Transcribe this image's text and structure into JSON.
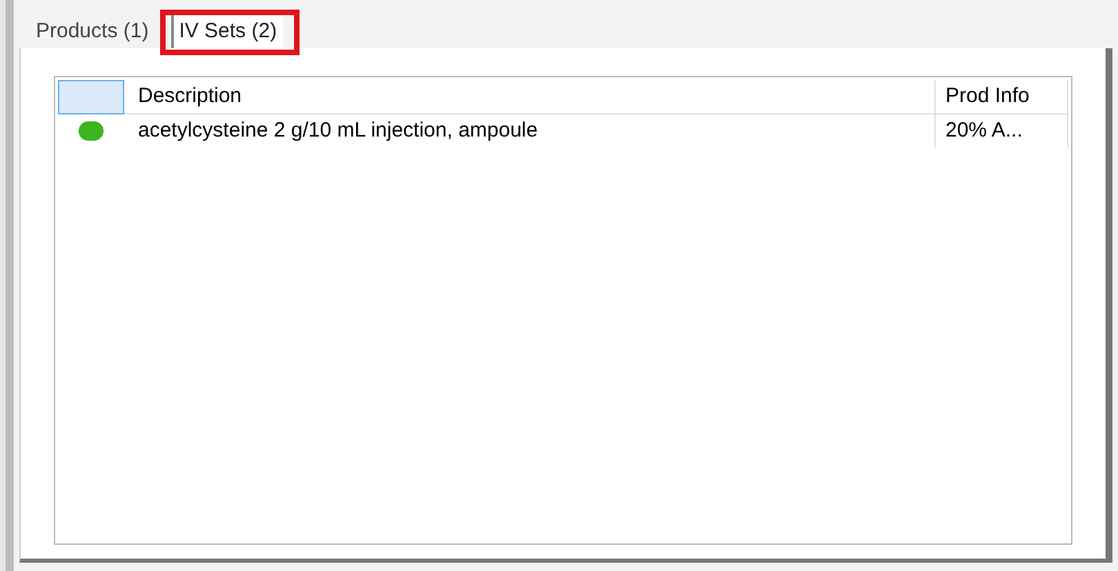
{
  "tabs": [
    {
      "label": "Products (1)",
      "selected": false,
      "highlighted": false
    },
    {
      "label": "IV Sets (2)",
      "selected": true,
      "highlighted": true
    }
  ],
  "table": {
    "columns": [
      "Description",
      "Prod Info"
    ],
    "rows": [
      {
        "color": "#3cb521",
        "description": "acetylcysteine 2 g/10 mL injection, ampoule",
        "prod_info": "20% A..."
      }
    ]
  }
}
